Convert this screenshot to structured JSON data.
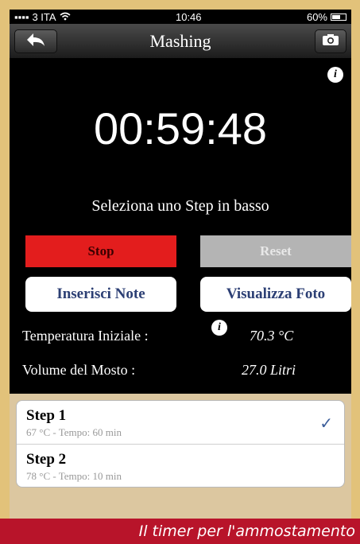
{
  "status_bar": {
    "carrier": "3 ITA",
    "time": "10:46",
    "battery": "60%",
    "battery_level": 0.6
  },
  "navbar": {
    "title": "Mashing",
    "back_icon": "back-arrow-icon",
    "camera_icon": "camera-icon"
  },
  "timer": {
    "value": "00:59:48"
  },
  "hint": "Seleziona uno Step in basso",
  "buttons": {
    "stop": "Stop",
    "reset": "Reset",
    "notes": "Inserisci Note",
    "photos": "Visualizza Foto"
  },
  "info": {
    "temperature_label": "Temperatura Iniziale :",
    "temperature_value": "70.3 °C",
    "volume_label": "Volume del Mosto :",
    "volume_value": "27.0 Litri"
  },
  "steps": [
    {
      "title": "Step 1",
      "subtitle": "67 °C - Tempo: 60 min",
      "checked": true
    },
    {
      "title": "Step 2",
      "subtitle": "78 °C - Tempo: 10 min",
      "checked": false
    }
  ],
  "caption": "Il timer per l'ammostamento",
  "colors": {
    "stop": "#e31d1d",
    "reset": "#b4b4b4",
    "button_text": "#2c3f74",
    "frame_red": "#b8142a"
  }
}
